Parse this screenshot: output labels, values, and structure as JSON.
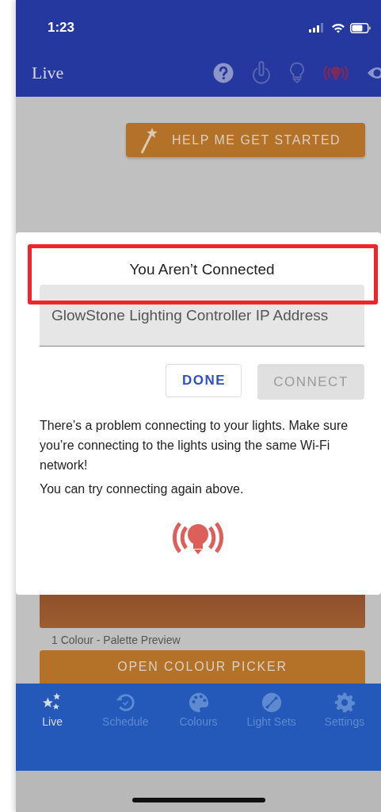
{
  "status_bar": {
    "time": "1:23"
  },
  "header": {
    "title": "Live",
    "actions": [
      {
        "kind": "help"
      },
      {
        "kind": "power"
      },
      {
        "kind": "bulb"
      },
      {
        "kind": "alert"
      },
      {
        "kind": "eye"
      }
    ]
  },
  "help_button": {
    "label": "HELP ME GET STARTED"
  },
  "palette": {
    "caption": "1 Colour - Palette Preview"
  },
  "picker_button": {
    "label": "OPEN COLOUR PICKER"
  },
  "dialog": {
    "title": "You Aren’t Connected",
    "field": {
      "placeholder": "GlowStone Lighting Controller IP Address"
    },
    "buttons": [
      {
        "label": "DONE",
        "disabled": false
      },
      {
        "label": "CONNECT",
        "disabled": true
      }
    ],
    "paragraphs": [
      "There’s a problem connecting to your lights. Make sure you’re connecting to the lights using the same Wi-Fi network!",
      "You can try connecting again above."
    ]
  },
  "tab_bar": [
    {
      "label": "Live",
      "kind": "stars",
      "selected": true
    },
    {
      "label": "Schedule",
      "kind": "schedule",
      "selected": false
    },
    {
      "label": "Colours",
      "kind": "palette",
      "selected": false
    },
    {
      "label": "Light Sets",
      "kind": "lightsets",
      "selected": false
    },
    {
      "label": "Settings",
      "kind": "gear",
      "selected": false
    }
  ]
}
